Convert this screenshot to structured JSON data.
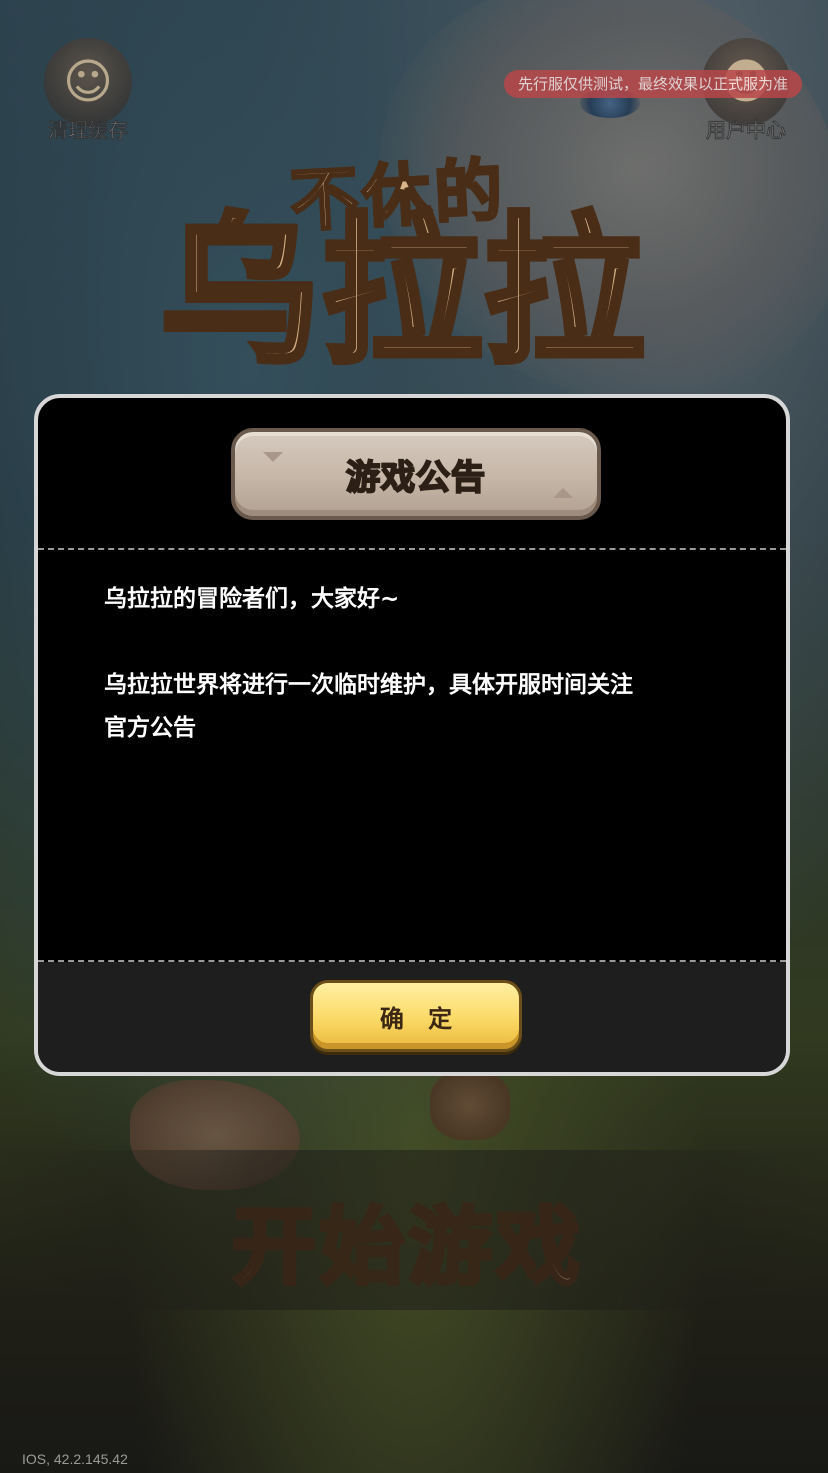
{
  "top_bar": {
    "clear_cache_label": "清理缓存",
    "user_center_label": "用户中心",
    "test_server_notice": "先行服仅供测试，最终效果以正式服为准"
  },
  "logo": {
    "line1": "不休的",
    "line2": "乌拉拉"
  },
  "dialog": {
    "title": "游戏公告",
    "greeting": "乌拉拉的冒险者们，大家好~",
    "message_line1": "乌拉拉世界将进行一次临时维护，具体开服时间关注",
    "message_line2": "官方公告",
    "confirm_label": "确 定"
  },
  "start_button_label": "开始游戏",
  "version_text": "IOS, 42.2.145.42",
  "colors": {
    "confirm_button": "#fbd966",
    "notice_pill": "#b8474a",
    "dialog_border": "#d7d7d7"
  },
  "icons": {
    "clear_cache": "caveman-avatar-icon",
    "user_center": "user-avatar-icon"
  }
}
